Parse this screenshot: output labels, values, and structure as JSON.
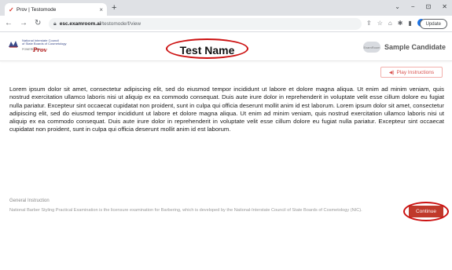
{
  "browser": {
    "tab_title": "Prov | Testomode",
    "tab_close": "×",
    "new_tab": "+",
    "window_controls": [
      "⌄",
      "−",
      "⊡",
      "✕"
    ],
    "url_host": "esc.examroom.ai",
    "url_path": "/testomode/f/view",
    "update_label": "Update",
    "profile_initial": "●"
  },
  "header": {
    "logo": {
      "line1": "National Interstate Council",
      "line2": "of State Boards of Cosmetology",
      "powered_by": "POWERED BY",
      "brand": "Prov"
    },
    "test_name": "Test Name",
    "candidate_avatar_label": "ExamRoom",
    "candidate_name": "Sample Candidate"
  },
  "controls": {
    "play_instructions": "Play Instructions",
    "continue": "Continue"
  },
  "passage": "Lorem ipsum dolor sit amet, consectetur adipiscing elit, sed do eiusmod tempor incididunt ut labore et dolore magna aliqua. Ut enim ad minim veniam, quis nostrud exercitation ullamco laboris nisi ut aliquip ex ea commodo consequat. Duis aute irure dolor in reprehenderit in voluptate velit esse cillum dolore eu fugiat nulla pariatur. Excepteur sint occaecat cupidatat non proident, sunt in culpa qui officia deserunt mollit anim id est laborum. Lorem ipsum dolor sit amet, consectetur adipiscing elit, sed do eiusmod tempor incididunt ut labore et dolore magna aliqua. Ut enim ad minim veniam, quis nostrud exercitation ullamco laboris nisi ut aliquip ex ea commodo consequat. Duis aute irure dolor in reprehenderit in voluptate velit esse cillum dolore eu fugiat nulla pariatur. Excepteur sint occaecat cupidatat non proident, sunt in culpa qui officia deserunt mollit anim id est laborum.",
  "general_instruction": {
    "title": "General Instruction",
    "text": "National Barber Styling Practical Examination is the licensure examination for Barbering, which is developed by the National-Interstate Council of State Boards of Cosmetology (NIC)."
  },
  "colors": {
    "accent": "#c0392b",
    "annotation": "#cc1111"
  }
}
